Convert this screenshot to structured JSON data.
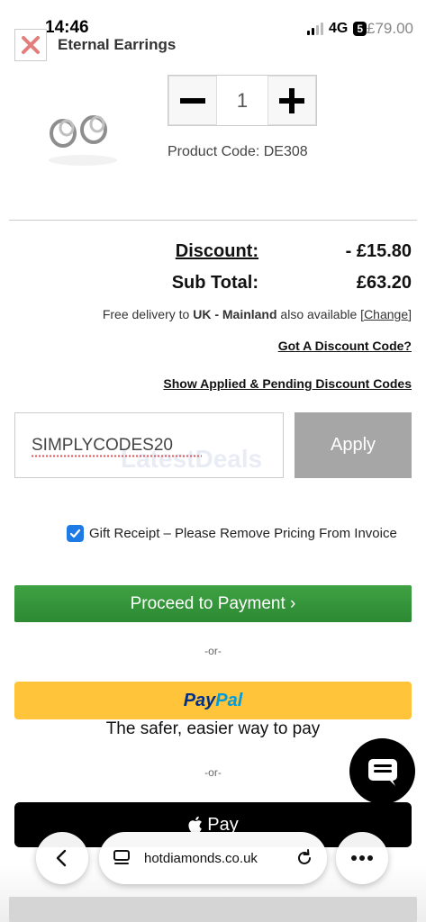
{
  "status_bar": {
    "time": "14:46",
    "network": "4G",
    "battery": "5",
    "overlay_price": "£79.00"
  },
  "cart_item": {
    "name": "Eternal Earrings",
    "quantity": "1",
    "product_code": "Product Code: DE308"
  },
  "totals": {
    "discount_label": "Discount:",
    "discount_value": "- £15.80",
    "subtotal_label": "Sub Total:",
    "subtotal_value": "£63.20"
  },
  "delivery": {
    "prefix": "Free delivery to ",
    "region": "UK - Mainland",
    "suffix": " also available [",
    "change_link": "Change",
    "close": "]"
  },
  "links": {
    "got_code": "Got A Discount Code?",
    "show_codes": "Show Applied & Pending Discount Codes"
  },
  "discount_form": {
    "code_value": "SIMPLYCODES20",
    "apply_label": "Apply"
  },
  "watermark": "LatestDeals",
  "gift_receipt": {
    "checked": true,
    "label": "Gift Receipt – Please Remove Pricing From Invoice"
  },
  "payment": {
    "proceed_label": "Proceed to Payment ›",
    "or_1": "-or-",
    "paypal_pay": "Pay",
    "paypal_pal": "Pal",
    "paypal_tagline": "The safer, easier way to pay",
    "or_2": "-or-",
    "applepay_label": "Pay"
  },
  "browser": {
    "url": "hotdiamonds.co.uk"
  },
  "colors": {
    "proceed_green": "#3ea143",
    "paypal_yellow": "#ffc439",
    "apply_grey": "#a6a6a6",
    "checkbox_blue": "#1e7be6"
  }
}
